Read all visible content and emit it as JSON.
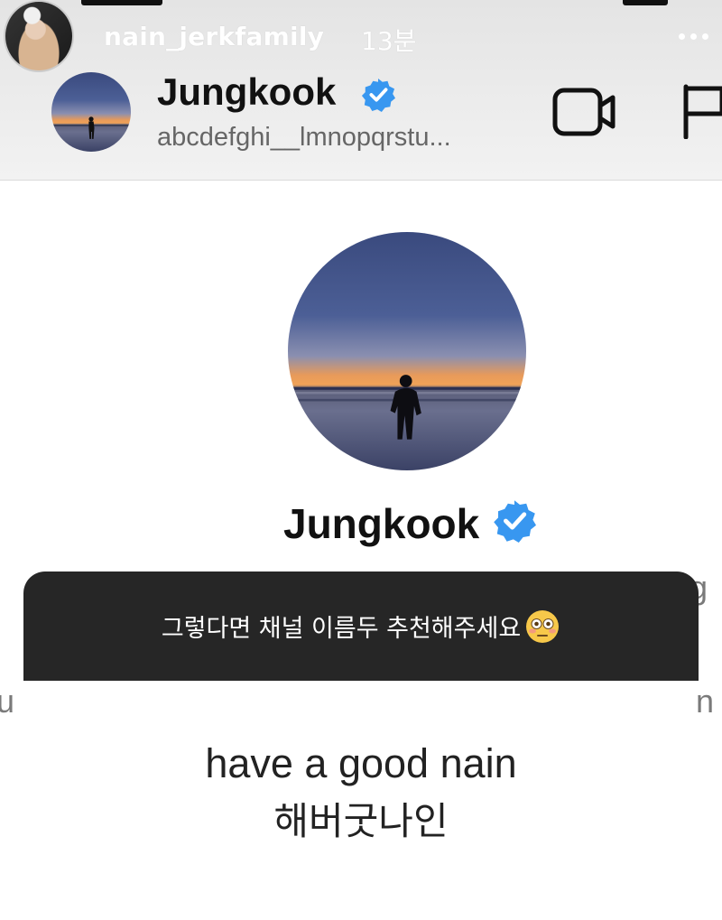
{
  "story": {
    "username": "nain_jerkfamily",
    "time_ago": "13분"
  },
  "profile": {
    "name": "Jungkook",
    "handle": "abcdefghi__lmnopqrstu...",
    "verified": true
  },
  "question": {
    "text": "그렇다면 채널 이름두 추천해주세요"
  },
  "answer": {
    "english": "have a good nain",
    "korean": "해버굿나인"
  },
  "background_fragments": {
    "left": "u",
    "right": "n",
    "right_top": "g"
  },
  "colors": {
    "verified_blue": "#3897f0",
    "sticker_bg": "#262626"
  },
  "icons": [
    "more-icon",
    "verified-badge-icon",
    "video-call-icon",
    "flag-icon",
    "flushed-face-emoji"
  ]
}
